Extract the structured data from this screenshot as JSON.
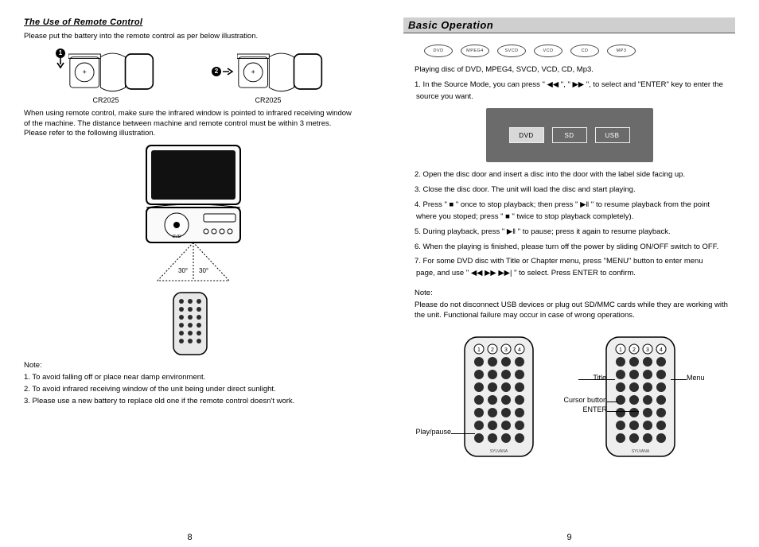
{
  "left": {
    "section_title": "The Use of Remote Control",
    "intro": "Please put the battery into the remote control as per below illustration.",
    "bat_label_a": "CR2025",
    "bat_label_b": "CR2025",
    "step1_num": "1",
    "step2_num": "2",
    "para2": "When using remote control, make sure the infrared window is pointed to infrared receiving window of the machine. The distance between machine and remote control must be within 3 metres. Please refer to the following illustration.",
    "cone_left": "30°",
    "cone_right": "30°",
    "note_head": "Note:",
    "note1": "1. To avoid falling off or place near damp environment.",
    "note2": "2. To avoid infrared receiving window of the unit being under direct sunlight.",
    "note3": "3. Please use a new battery to replace old one if the remote control doesn't work.",
    "page_num": "8",
    "dvd_text": "DVD"
  },
  "right": {
    "title": "Basic Operation",
    "discs": [
      "DVD",
      "MPEG4",
      "SVCD",
      "VCD",
      "CD",
      "MP3"
    ],
    "play_line": "Playing disc of DVD, MPEG4, SVCD, VCD, CD, Mp3.",
    "item1": "1. In the Source Mode, you can press \" ◀◀ \", \" ▶▶ \", to select and \"ENTER\" key to enter the",
    "item1b": "source you want.",
    "src": {
      "a": "DVD",
      "b": "SD",
      "c": "USB"
    },
    "item2": "2. Open the disc door and insert a disc into the door with  the label side facing up.",
    "item3": "3. Close the disc door. The unit will load the disc and start playing.",
    "item4": "4. Press \" ■ \" once to stop playback; then press \" ▶‖ \" to resume playback from the point",
    "item4b": "where you stoped; press \" ■ \" twice to stop playback completely).",
    "item5": "5. During playback, press \" ▶‖ \" to pause; press it again to resume playback.",
    "item6": "6. When the playing is finished, please turn off the power by sliding ON/OFF switch to OFF.",
    "item7": "7. For some DVD disc with Title or Chapter menu, press \"MENU\" button to enter menu",
    "item7b": "page, and use \" ◀◀ ▶▶ ▶▶| \" to select. Press ENTER to confirm.",
    "note_head": "Note:",
    "note_body": "Please do not disconnect USB devices or plug out SD/MMC cards while they are working with the unit. Functional failure may occur in case of wrong operations.",
    "callouts": {
      "playpause": "Play/pause",
      "title": "Title",
      "menu": "Menu",
      "cursor": "Cursor button",
      "enter": "ENTER"
    },
    "r1": "1",
    "r2": "2",
    "r3": "3",
    "r4": "4",
    "page_num": "9"
  }
}
